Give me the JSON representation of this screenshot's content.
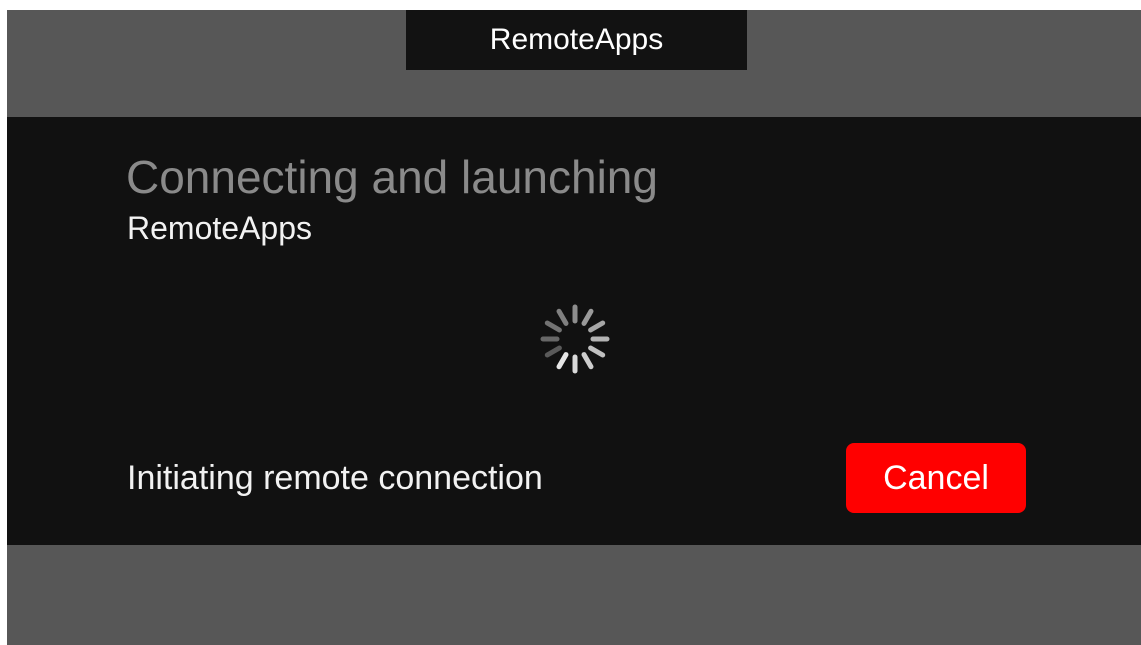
{
  "window": {
    "title": "RemoteApps"
  },
  "dialog": {
    "heading": "Connecting and launching",
    "app_name": "RemoteApps",
    "status_text": "Initiating remote connection",
    "cancel_label": "Cancel",
    "spinner_icon": "loading-spinner-icon"
  },
  "colors": {
    "backdrop": "#575757",
    "dialog_bg": "#111111",
    "heading": "#8a8a8a",
    "cancel_button": "#ff0000"
  }
}
